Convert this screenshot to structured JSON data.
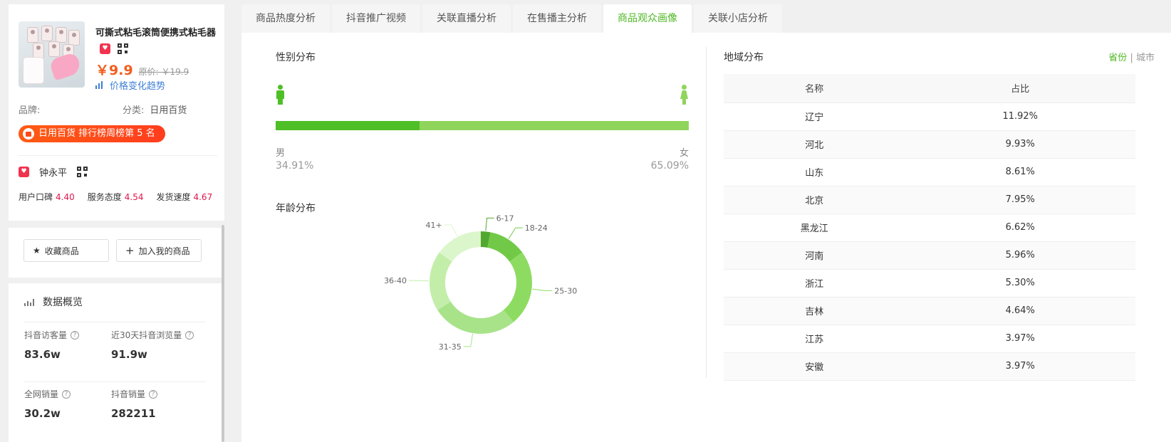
{
  "product": {
    "title": "可撕式粘毛滚筒便携式粘毛器",
    "price": "￥9.9",
    "orig_price": "原价: ￥19.9",
    "trend_link": "价格变化趋势",
    "brand_label": "品牌:",
    "category_label": "分类:",
    "category": "日用百货",
    "rank_badge": "日用百货 排行榜周榜第 5 名"
  },
  "shop": {
    "name": "钟永平",
    "ratings": [
      {
        "label": "用户口碑",
        "value": "4.40"
      },
      {
        "label": "服务态度",
        "value": "4.54"
      },
      {
        "label": "发货速度",
        "value": "4.67"
      }
    ]
  },
  "buttons": {
    "favorite": "收藏商品",
    "add": "加入我的商品"
  },
  "overview": {
    "title": "数据概览",
    "stats": [
      {
        "label": "抖音访客量",
        "value": "83.6w"
      },
      {
        "label": "近30天抖音浏览量",
        "value": "91.9w"
      },
      {
        "label": "全网销量",
        "value": "30.2w"
      },
      {
        "label": "抖音销量",
        "value": "282211"
      }
    ]
  },
  "tabs": [
    "商品热度分析",
    "抖音推广视频",
    "关联直播分析",
    "在售播主分析",
    "商品观众画像",
    "关联小店分析"
  ],
  "active_tab": 4,
  "gender": {
    "title": "性别分布",
    "male_label": "男",
    "female_label": "女",
    "male_pct": "34.91%",
    "female_pct": "65.09%",
    "male_value": 34.91,
    "colors": {
      "male": "#4fbf27",
      "female": "#8fd55b"
    }
  },
  "age": {
    "title": "年龄分布",
    "chart_data": {
      "type": "pie",
      "categories": [
        "6-17",
        "18-24",
        "25-30",
        "31-35",
        "36-40",
        "41+"
      ],
      "values": [
        3,
        12,
        24,
        27,
        19,
        15
      ],
      "colors": [
        "#52a82f",
        "#72c948",
        "#8edb62",
        "#a8e38a",
        "#c3eeaa",
        "#dcf6cc"
      ]
    }
  },
  "region": {
    "title": "地域分布",
    "toggle": {
      "province": "省份",
      "sep": "|",
      "city": "城市"
    },
    "headers": [
      "名称",
      "占比"
    ],
    "rows": [
      {
        "name": "辽宁",
        "pct": "11.92%"
      },
      {
        "name": "河北",
        "pct": "9.93%"
      },
      {
        "name": "山东",
        "pct": "8.61%"
      },
      {
        "name": "北京",
        "pct": "7.95%"
      },
      {
        "name": "黑龙江",
        "pct": "6.62%"
      },
      {
        "name": "河南",
        "pct": "5.96%"
      },
      {
        "name": "浙江",
        "pct": "5.30%"
      },
      {
        "name": "吉林",
        "pct": "4.64%"
      },
      {
        "name": "江苏",
        "pct": "3.97%"
      },
      {
        "name": "安徽",
        "pct": "3.97%"
      }
    ]
  }
}
